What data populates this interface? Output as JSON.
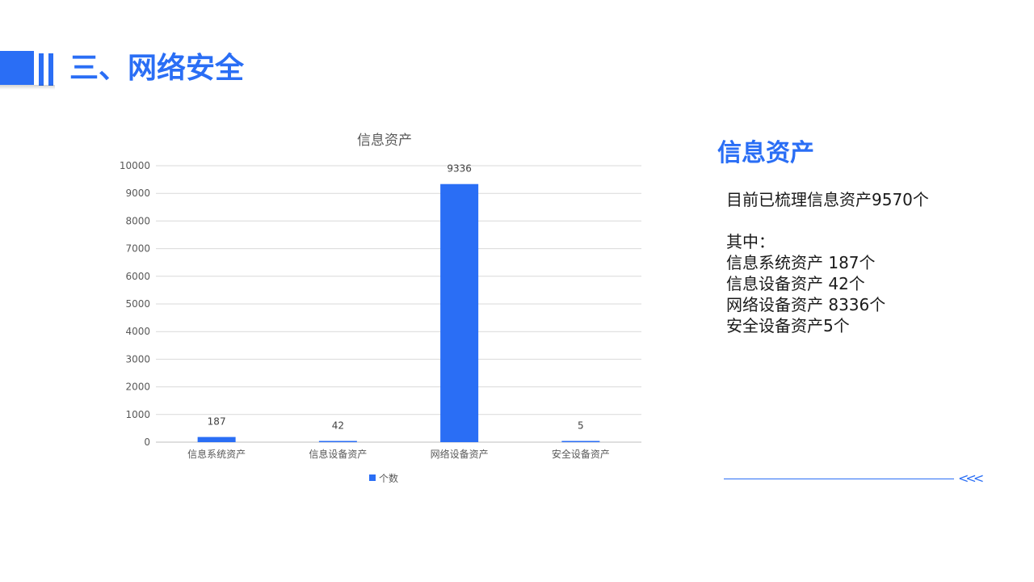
{
  "header": {
    "title": "三、网络安全"
  },
  "colors": {
    "accent": "#2a6ef5",
    "bar": "#2a6ef5",
    "grid": "#d9d9d9",
    "axis_text": "#595959"
  },
  "chart_data": {
    "type": "bar",
    "title": "信息资产",
    "categories": [
      "信息系统资产",
      "信息设备资产",
      "网络设备资产",
      "安全设备资产"
    ],
    "series": [
      {
        "name": "个数",
        "values": [
          187,
          42,
          9336,
          5
        ]
      }
    ],
    "data_labels": [
      "187",
      "42",
      "9336",
      "5"
    ],
    "ylim": [
      0,
      10000
    ],
    "yticks": [
      "0",
      "1000",
      "2000",
      "3000",
      "4000",
      "5000",
      "6000",
      "7000",
      "8000",
      "9000",
      "10000"
    ],
    "grid": true,
    "legend_position": "bottom"
  },
  "side": {
    "heading": "信息资产",
    "summary": "目前已梳理信息资产9570个",
    "breakdown_label": "其中：",
    "items": [
      "信息系统资产 187个",
      "信息设备资产 42个",
      "网络设备资产 8336个",
      "安全设备资产5个"
    ]
  },
  "footer": {
    "arrow_icon": "<<<"
  }
}
